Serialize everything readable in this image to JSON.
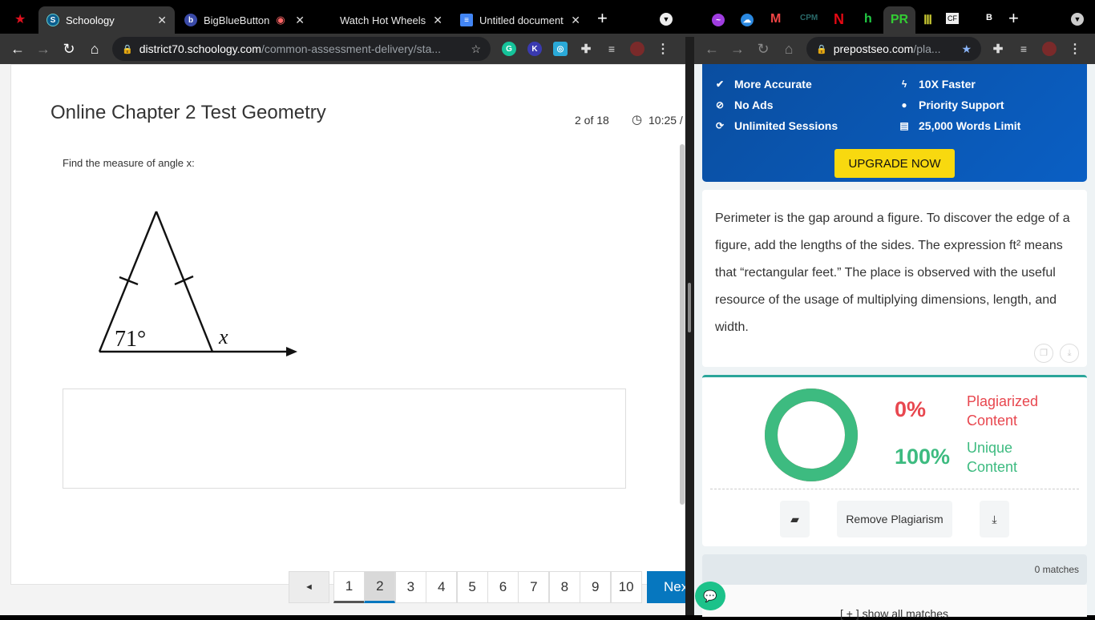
{
  "left_browser": {
    "tabs": [
      {
        "label": "Schoology",
        "active": true
      },
      {
        "label": "BigBlueButton"
      },
      {
        "label": "Watch Hot Wheels"
      },
      {
        "label": "Untitled document"
      }
    ],
    "url_host": "district70.schoology.com",
    "url_path": "/common-assessment-delivery/sta..."
  },
  "test": {
    "title": "Online Chapter 2 Test Geometry",
    "progress": "2 of 18",
    "timer": "10:25 /",
    "question": "Find the measure of angle x:",
    "figure": {
      "angle_label": "71°",
      "unknown_label": "x"
    },
    "pages": [
      "1",
      "2",
      "3",
      "4",
      "5",
      "6",
      "7",
      "8",
      "9",
      "10"
    ],
    "current_page": "2",
    "prev_label": "◄",
    "next_label": "Next"
  },
  "right_browser": {
    "url_host": "prepostseo.com",
    "url_path": "/pla..."
  },
  "upgrade": {
    "features": [
      "More Accurate",
      "No Ads",
      "Unlimited Sessions",
      "10X Faster",
      "Priority Support",
      "25,000 Words Limit"
    ],
    "button": "UPGRADE NOW"
  },
  "result_text": "Perimeter is the gap around a figure. To discover the edge of a figure, add the lengths of the sides. The expression ft² means that “rectangular feet.” The place is observed with the useful resource of the usage of multiplying dimensions, length, and width.",
  "report": {
    "plagiarized_pct": "0%",
    "plagiarized_label": "Plagiarized Content",
    "unique_pct": "100%",
    "unique_label": "Unique Content",
    "unique_fraction": 1.0,
    "remove_button": "Remove Plagiarism",
    "matches": "0 matches",
    "show_all": "[ + ] show all matches",
    "colors": {
      "plagiarized": "#e8474f",
      "unique": "#3dbb80"
    }
  }
}
